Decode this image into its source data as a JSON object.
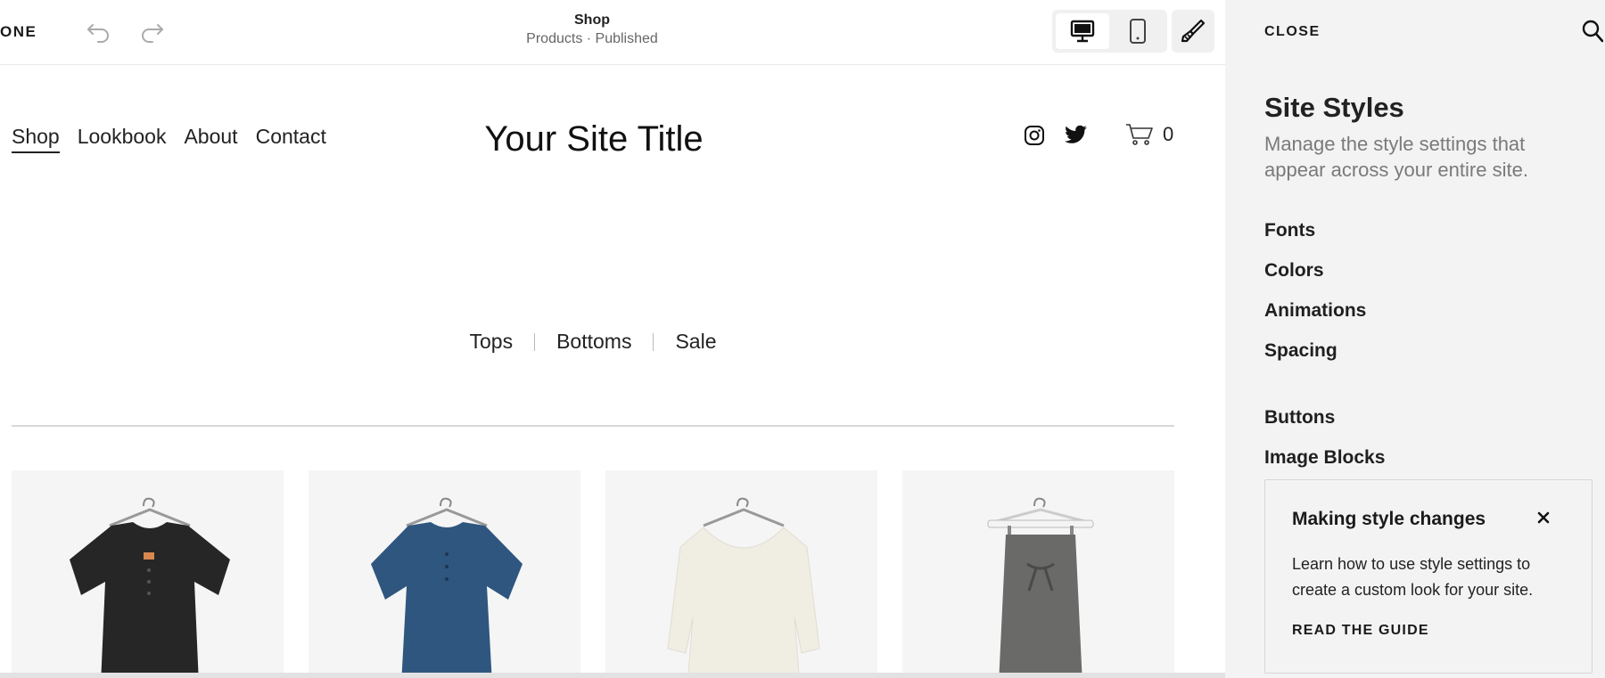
{
  "topbar": {
    "done_label": "ONE",
    "page_name": "Shop",
    "page_status": "Products · Published"
  },
  "site": {
    "nav": [
      "Shop",
      "Lookbook",
      "About",
      "Contact"
    ],
    "title": "Your Site Title",
    "cart_count": "0",
    "categories": [
      "Tops",
      "Bottoms",
      "Sale"
    ],
    "products": [
      {
        "name": "black-linen-top",
        "color": "#262626"
      },
      {
        "name": "blue-linen-top",
        "color": "#2f567f"
      },
      {
        "name": "white-top",
        "color": "#f0ede3"
      },
      {
        "name": "gray-skirt",
        "color": "#6a6a68"
      }
    ]
  },
  "panel": {
    "close_label": "CLOSE",
    "title": "Site Styles",
    "description": "Manage the style settings that appear across your entire site.",
    "items": [
      "Fonts",
      "Colors",
      "Animations",
      "Spacing",
      "Buttons",
      "Image Blocks"
    ],
    "guide": {
      "title": "Making style changes",
      "text": "Learn how to use style settings to create a custom look for your site.",
      "link": "READ THE GUIDE"
    }
  },
  "icons": {
    "undo": "undo-icon",
    "redo": "redo-icon",
    "desktop": "desktop-icon",
    "mobile": "mobile-icon",
    "style": "paintbrush-icon",
    "instagram": "instagram-icon",
    "twitter": "twitter-icon",
    "cart": "cart-icon",
    "search": "search-icon",
    "close": "close-icon"
  }
}
